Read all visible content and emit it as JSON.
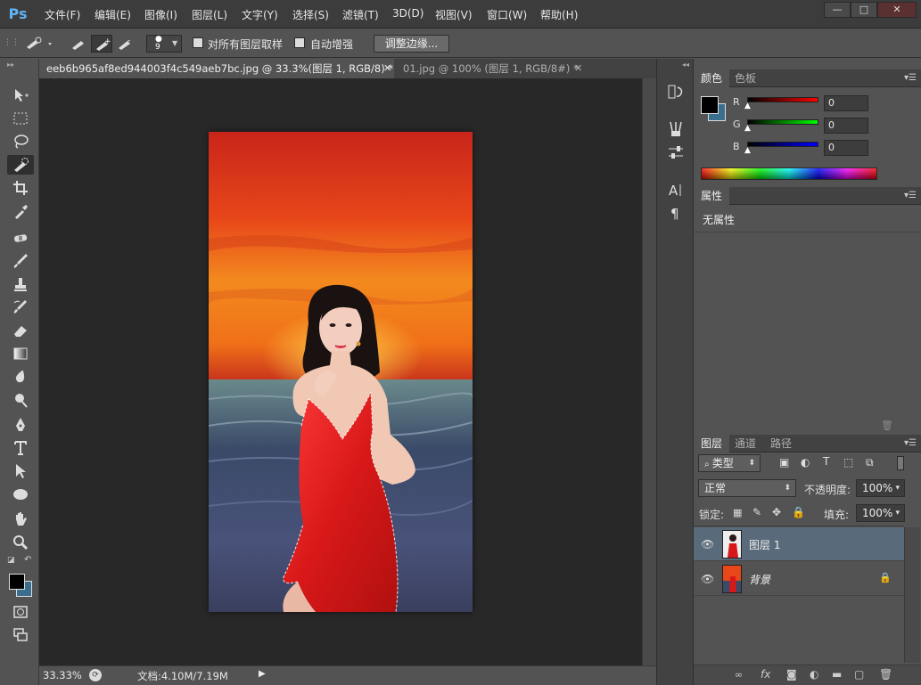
{
  "app": {
    "logo": "Ps"
  },
  "menu": [
    "文件(F)",
    "编辑(E)",
    "图像(I)",
    "图层(L)",
    "文字(Y)",
    "选择(S)",
    "滤镜(T)",
    "3D(D)",
    "视图(V)",
    "窗口(W)",
    "帮助(H)"
  ],
  "window_buttons": {
    "minimize": "—",
    "restore": "□",
    "close": "✕"
  },
  "options": {
    "brush_size": "9",
    "sample_all_layers": "对所有图层取样",
    "auto_enhance": "自动增强",
    "refine_edge": "调整边缘..."
  },
  "tabs": [
    {
      "label": "eeb6b965af8ed944003f4c549aeb7bc.jpg @ 33.3%(图层 1, RGB/8) *",
      "active": true
    },
    {
      "label": "01.jpg @ 100% (图层 1, RGB/8#) *",
      "active": false
    }
  ],
  "status": {
    "zoom": "33.33%",
    "doc": "文档:4.10M/7.19M"
  },
  "color_panel": {
    "tabs": [
      "颜色",
      "色板"
    ],
    "channels": [
      {
        "label": "R",
        "value": "0"
      },
      {
        "label": "G",
        "value": "0"
      },
      {
        "label": "B",
        "value": "0"
      }
    ],
    "foreground": "#000000",
    "background": "#3a6e8f"
  },
  "properties_panel": {
    "tab": "属性",
    "empty_text": "无属性"
  },
  "layers_panel": {
    "tabs": [
      "图层",
      "通道",
      "路径"
    ],
    "filter_kind": "类型",
    "blend_mode": "正常",
    "opacity_label": "不透明度:",
    "opacity_value": "100%",
    "lock_label": "锁定:",
    "fill_label": "填充:",
    "fill_value": "100%",
    "layers": [
      {
        "name": "图层 1",
        "selected": true,
        "locked": false
      },
      {
        "name": "背景",
        "selected": false,
        "locked": true
      }
    ]
  }
}
